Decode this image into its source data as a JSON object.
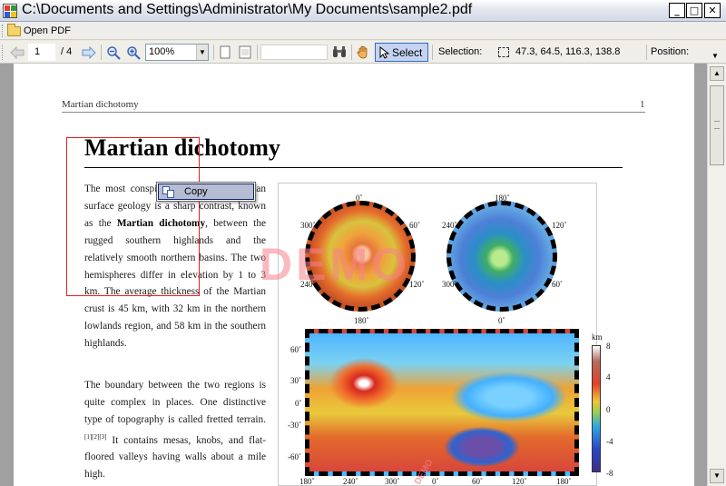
{
  "window": {
    "title": "C:\\Documents and Settings\\Administrator\\My Documents\\sample2.pdf",
    "controls": {
      "minimize": "_",
      "maximize": "□",
      "close": "✕"
    }
  },
  "menu": {
    "open_pdf": "Open PDF"
  },
  "toolbar": {
    "page_current": "1",
    "page_total": "/ 4",
    "zoom": "100%",
    "select_label": "Select",
    "selection_label": "Selection:",
    "selection_value": "47.3, 64.5, 116.3, 138.8",
    "position_label": "Position:"
  },
  "document": {
    "running_head": "Martian dichotomy",
    "page_number": "1",
    "title": "Martian dichotomy",
    "para1": {
      "before": "The most conspicuous feature of Martian surface geology is a sharp contrast, known as the",
      "bold_term": "Martian dichotomy",
      "after": ", between the rugged southern highlands and the relatively smooth northern basins. The two hemispheres differ in elevation by 1 to 3 km. The average thickness of the Martian crust is 45 km, with 32 km in the northern lowlands region, and 58 km in the southern highlands."
    },
    "para2": {
      "before": "The boundary between the two regions is quite complex in places. One distinctive type of topography is called fretted terrain.",
      "refs": "[1][2][3]",
      "after": " It contains mesas, knobs, and flat-floored valleys having walls about a mile high."
    },
    "watermark": "DEMO",
    "watermark_small": "DEMO"
  },
  "figure": {
    "globe1_labels": [
      "0˚",
      "300˚",
      "60˚",
      "240˚",
      "120˚",
      "180˚"
    ],
    "globe2_labels": [
      "180˚",
      "240˚",
      "120˚",
      "300˚",
      "60˚",
      "0˚"
    ],
    "lat_labels": [
      "60˚",
      "30˚",
      "0˚",
      "-30˚",
      "-60˚"
    ],
    "lon_labels": [
      "180˚",
      "240˚",
      "300˚",
      "0˚",
      "60˚",
      "120˚",
      "180˚"
    ],
    "scale_unit": "km",
    "scale_ticks": [
      "8",
      "4",
      "0",
      "-4",
      "-8"
    ]
  },
  "context_menu": {
    "copy": "Copy"
  }
}
